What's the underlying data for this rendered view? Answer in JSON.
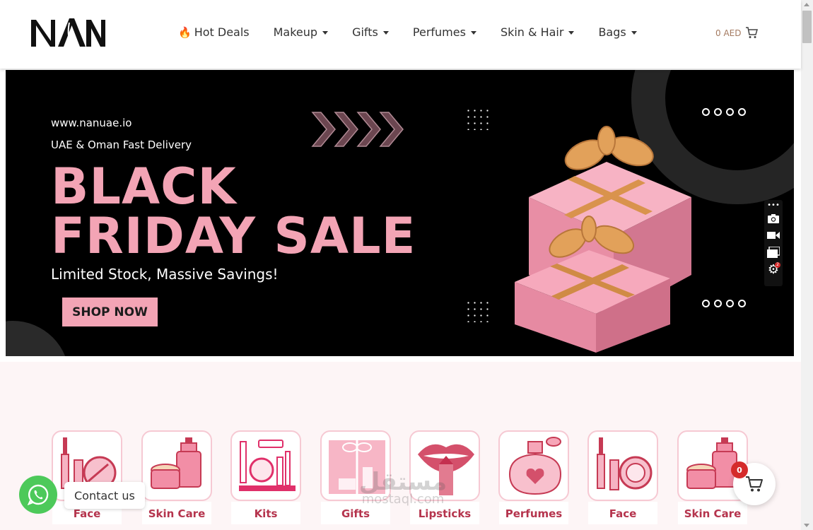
{
  "header": {
    "logo_text": "NAN",
    "nav": [
      {
        "label": "Hot Deals",
        "icon": "flame-icon",
        "has_dropdown": false
      },
      {
        "label": "Makeup",
        "has_dropdown": true
      },
      {
        "label": "Gifts",
        "has_dropdown": true
      },
      {
        "label": "Perfumes",
        "has_dropdown": true
      },
      {
        "label": "Skin & Hair",
        "has_dropdown": true
      },
      {
        "label": "Bags",
        "has_dropdown": true
      }
    ],
    "cart_total": "0 AED"
  },
  "banner": {
    "url": "www.nanuae.io",
    "delivery": "UAE & Oman Fast Delivery",
    "headline_line1": "BLACK",
    "headline_line2": "FRIDAY SALE",
    "subheadline": "Limited Stock, Massive Savings!",
    "cta": "SHOP NOW",
    "accent_color": "#f3a4b5"
  },
  "media_toolbar": {
    "icons": [
      "more-icon",
      "camera-icon",
      "video-icon",
      "gallery-icon",
      "settings-icon"
    ],
    "settings_badge": "2"
  },
  "categories": [
    {
      "label": "Face",
      "icon": "face-makeup-icon"
    },
    {
      "label": "Skin Care",
      "icon": "skin-care-icon"
    },
    {
      "label": "Kits",
      "icon": "kits-icon"
    },
    {
      "label": "Gifts",
      "icon": "gifts-icon"
    },
    {
      "label": "Lipsticks",
      "icon": "lipstick-icon"
    },
    {
      "label": "Perfumes",
      "icon": "perfume-icon"
    },
    {
      "label": "Face",
      "icon": "face-makeup-icon"
    },
    {
      "label": "Skin Care",
      "icon": "skin-care-icon"
    }
  ],
  "watermark": {
    "arabic": "مستقل",
    "latin": "mostaql.com"
  },
  "whatsapp": {
    "label": "Contact us"
  },
  "floating_cart": {
    "count": "0"
  }
}
